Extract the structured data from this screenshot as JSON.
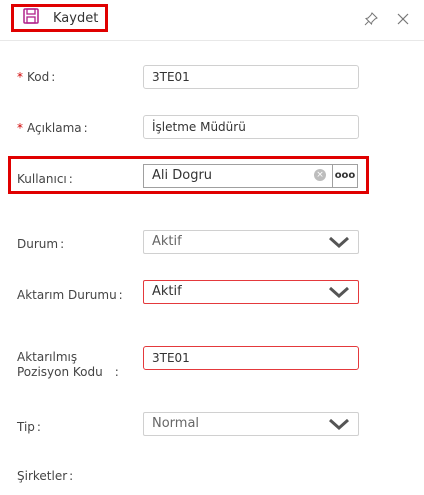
{
  "toolbar": {
    "save_label": "Kaydet"
  },
  "form": {
    "kod": {
      "label": "Kod",
      "required": "*",
      "value": "3TE01"
    },
    "aciklama": {
      "label": "Açıklama",
      "required": "*",
      "value": "İşletme Müdürü"
    },
    "kullanici": {
      "label": "Kullanıcı",
      "value": "Ali Dogru",
      "clear_glyph": "×",
      "more_glyph": "ooo"
    },
    "durum": {
      "label": "Durum",
      "value": "Aktif"
    },
    "aktarim_durumu": {
      "label": "Aktarım Durumu",
      "value": "Aktif"
    },
    "aktarilmis_pozisyon": {
      "label_line1": "Aktarılmış",
      "label_line2": "Pozisyon Kodu",
      "value": "3TE01"
    },
    "tip": {
      "label": "Tip",
      "value": "Normal"
    },
    "sirketler": {
      "label": "Şirketler"
    },
    "colon": ":"
  },
  "colors": {
    "required": "#d00000",
    "error_border": "#e4393c",
    "highlight": "#e00000",
    "save_icon": "#b0208a"
  }
}
